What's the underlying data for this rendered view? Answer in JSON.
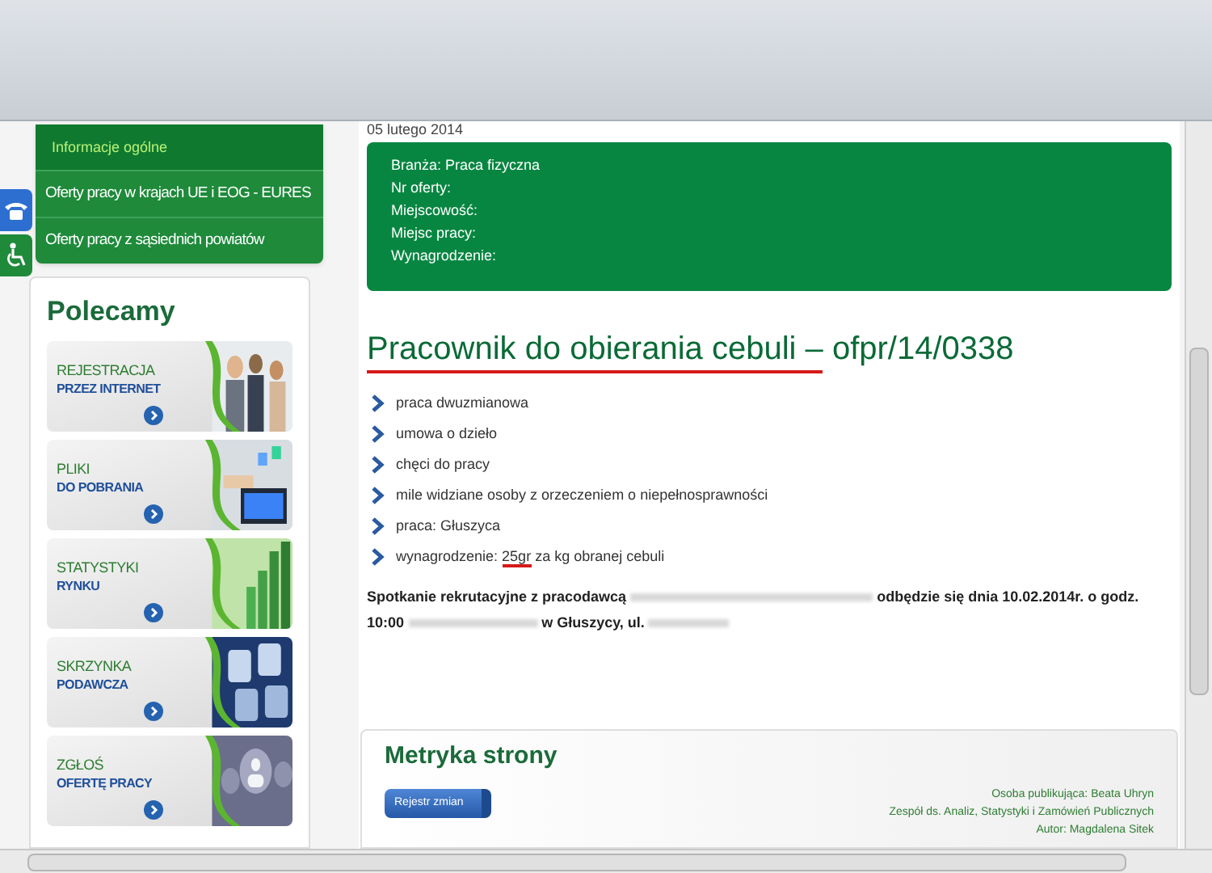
{
  "sidebar": {
    "nav": [
      {
        "label": "Informacje ogólne",
        "kind": "subitem",
        "selected": true
      },
      {
        "label": "Oferty pracy w krajach UE i EOG - EURES",
        "kind": "item",
        "selected": false
      },
      {
        "label": "Oferty pracy z sąsiednich powiatów",
        "kind": "item",
        "selected": false
      }
    ],
    "recommended": {
      "title": "Polecamy",
      "banners": [
        {
          "line1": "REJESTRACJA",
          "line2": "PRZEZ INTERNET"
        },
        {
          "line1": "PLIKI",
          "line2": "DO POBRANIA"
        },
        {
          "line1": "STATYSTYKI",
          "line2": "RYNKU"
        },
        {
          "line1": "SKRZYNKA",
          "line2": "PODAWCZA"
        },
        {
          "line1": "ZGŁOŚ",
          "line2": "OFERTĘ PRACY"
        }
      ]
    }
  },
  "offer": {
    "date": "05 lutego 2014",
    "details": [
      "Branża: Praca fizyczna",
      "Nr oferty:",
      "Miejscowość:",
      "Miejsc pracy:",
      "Wynagrodzenie:"
    ],
    "title": {
      "underlined": "Pracownik do obierania cebuli –",
      "rest": " ofpr/14/0338"
    },
    "features": [
      {
        "kind": "plain",
        "text": "praca dwuzmianowa"
      },
      {
        "kind": "plain",
        "text": "umowa o dzieło"
      },
      {
        "kind": "plain",
        "text": "chęci do pracy"
      },
      {
        "kind": "plain",
        "text": "mile widziane osoby z orzeczeniem o niepełnosprawności"
      },
      {
        "kind": "plain",
        "text": "praca: Głuszyca"
      },
      {
        "kind": "annotated",
        "before": "wynagrodzenie: ",
        "underlined": "25gr",
        "after": " za kg obranej cebuli"
      }
    ],
    "meeting": [
      "Spotkanie rekrutacyjne z pracodawcą",
      "odbędzie się dnia 10.02.2014r. o godz. 10:00",
      "w Głuszycy, ul."
    ]
  },
  "metrics": {
    "title": "Metryka strony",
    "button": "Rejestr zmian",
    "lines": [
      "Osoba publikująca: Beata Uhryn",
      "Zespół ds. Analiz, Statystyki i Zamówień Publicznych",
      "Autor: Magdalena Sitek"
    ]
  }
}
